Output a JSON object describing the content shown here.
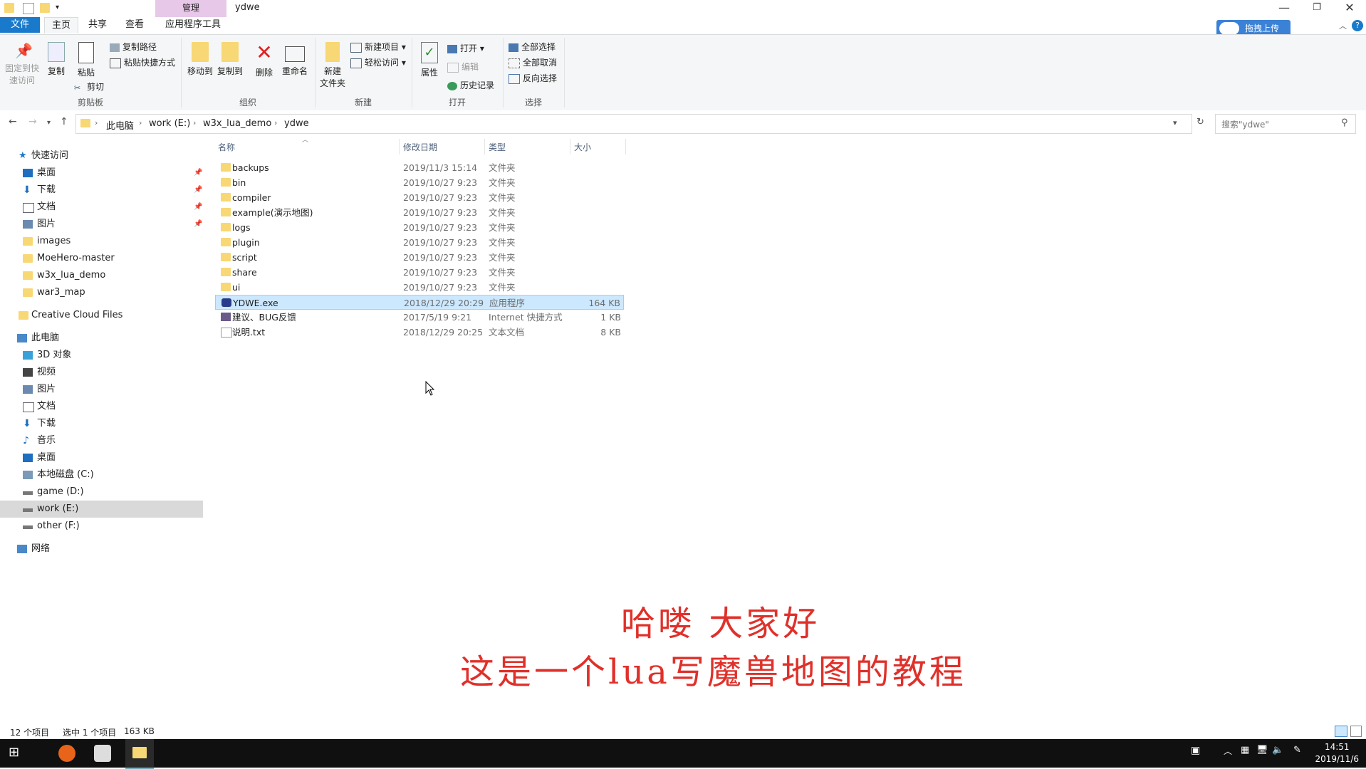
{
  "window": {
    "title": "ydwe",
    "manage_tab": "管理",
    "buttons": {
      "minimize": "—",
      "restore": "❐",
      "close": "✕"
    }
  },
  "tabs": [
    "文件",
    "主页",
    "共享",
    "查看",
    "应用程序工具"
  ],
  "upload_button": "拖拽上传",
  "ribbon": {
    "clipboard": {
      "pin": "固定到快速访问",
      "pin_line1": "固定到快",
      "pin_line2": "速访问",
      "copy": "复制",
      "paste": "粘贴",
      "copy_path": "复制路径",
      "paste_shortcut": "粘贴快捷方式",
      "cut": "剪切",
      "group": "剪贴板"
    },
    "organize": {
      "move_to": "移动到",
      "copy_to": "复制到",
      "delete": "删除",
      "rename": "重命名",
      "group": "组织"
    },
    "new": {
      "new_folder_line1": "新建",
      "new_folder_line2": "文件夹",
      "new_item": "新建项目 ▾",
      "easy_access": "轻松访问 ▾",
      "group": "新建"
    },
    "open": {
      "properties": "属性",
      "open": "打开 ▾",
      "edit": "编辑",
      "history": "历史记录",
      "group": "打开"
    },
    "select": {
      "select_all": "全部选择",
      "select_none": "全部取消",
      "invert": "反向选择",
      "group": "选择"
    }
  },
  "address": {
    "breadcrumbs": [
      "此电脑",
      "work (E:)",
      "w3x_lua_demo",
      "ydwe"
    ],
    "search_placeholder": "搜索\"ydwe\""
  },
  "nav": {
    "quick_access": "快速访问",
    "quick_items": [
      "桌面",
      "下载",
      "文档",
      "图片",
      "images",
      "MoeHero-master",
      "w3x_lua_demo",
      "war3_map"
    ],
    "creative_cloud": "Creative Cloud Files",
    "this_pc": "此电脑",
    "pc_items": [
      "3D 对象",
      "视频",
      "图片",
      "文档",
      "下载",
      "音乐",
      "桌面",
      "本地磁盘 (C:)",
      "game (D:)",
      "work (E:)",
      "other (F:)"
    ],
    "network": "网络"
  },
  "columns": [
    "名称",
    "修改日期",
    "类型",
    "大小"
  ],
  "files": [
    {
      "name": "backups",
      "date": "2019/11/3 15:14",
      "type": "文件夹",
      "size": ""
    },
    {
      "name": "bin",
      "date": "2019/10/27 9:23",
      "type": "文件夹",
      "size": ""
    },
    {
      "name": "compiler",
      "date": "2019/10/27 9:23",
      "type": "文件夹",
      "size": ""
    },
    {
      "name": "example(演示地图)",
      "date": "2019/10/27 9:23",
      "type": "文件夹",
      "size": ""
    },
    {
      "name": "logs",
      "date": "2019/10/27 9:23",
      "type": "文件夹",
      "size": ""
    },
    {
      "name": "plugin",
      "date": "2019/10/27 9:23",
      "type": "文件夹",
      "size": ""
    },
    {
      "name": "script",
      "date": "2019/10/27 9:23",
      "type": "文件夹",
      "size": ""
    },
    {
      "name": "share",
      "date": "2019/10/27 9:23",
      "type": "文件夹",
      "size": ""
    },
    {
      "name": "ui",
      "date": "2019/10/27 9:23",
      "type": "文件夹",
      "size": ""
    },
    {
      "name": "YDWE.exe",
      "date": "2018/12/29 20:29",
      "type": "应用程序",
      "size": "164 KB"
    },
    {
      "name": "建议、BUG反馈",
      "date": "2017/5/19 9:21",
      "type": "Internet 快捷方式",
      "size": "1 KB"
    },
    {
      "name": "说明.txt",
      "date": "2018/12/29 20:25",
      "type": "文本文档",
      "size": "8 KB"
    }
  ],
  "caption": {
    "line1": "哈喽 大家好",
    "line2": "这是一个lua写魔兽地图的教程"
  },
  "status": {
    "count": "12 个项目",
    "selected": "选中 1 个项目",
    "size": "163 KB"
  },
  "clock": {
    "time": "14:51",
    "date": "2019/11/6"
  },
  "colors": {
    "accent": "#1979ca",
    "selection": "#cce8ff",
    "caption": "#e0302a",
    "folder": "#f8d775"
  }
}
